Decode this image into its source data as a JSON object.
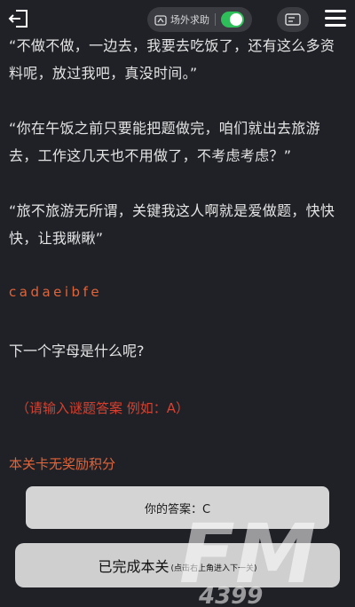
{
  "header": {
    "help_label": "场外求助"
  },
  "story": {
    "para1": "“不做不做，一边去，我要去吃饭了，还有这么多资料呢，放过我吧，真没时间。”",
    "para2": "“你在午饭之前只要能把题做完，咱们就出去旅游去，工作这几天也不用做了，不考虑考虑？”",
    "para3": "“旅不旅游无所谓，关键我这人啊就是爱做题，快快快，让我瞅瞅”",
    "code": "cadaeibfe",
    "question": "下一个字母是什么呢?"
  },
  "hint": "（请输入谜题答案 例如：A）",
  "reward": "本关卡无奖励积分",
  "answer": {
    "label": "你的答案：C"
  },
  "done_button": {
    "main": "已完成本关",
    "sub": "(点击右上角进入下一关)"
  },
  "watermark": {
    "big": "FM",
    "small": "4399"
  },
  "colors": {
    "background": "#1f2126",
    "accent_orange": "#e0643a",
    "hint_red": "#d9402f",
    "toggle_green": "#2fbf5a"
  }
}
